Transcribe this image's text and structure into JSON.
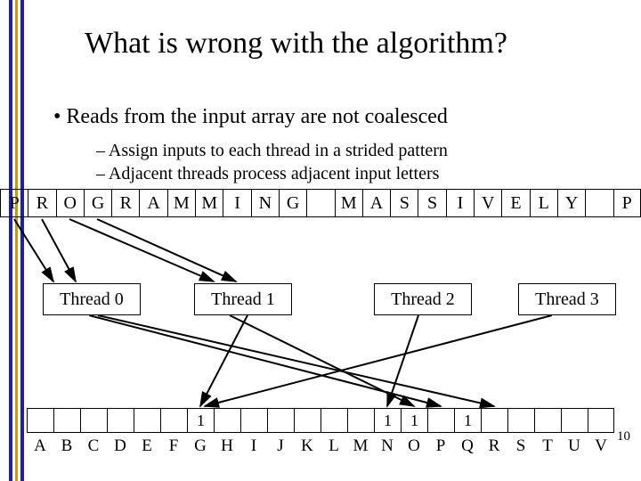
{
  "title": "What is wrong with the algorithm?",
  "bullet1": "Reads from the input array are not coalesced",
  "bullet2a": "Assign inputs to each thread in a strided pattern",
  "bullet2b": "Adjacent threads process adjacent input letters",
  "input_letters": [
    "P",
    "R",
    "O",
    "G",
    "R",
    "A",
    "M",
    "M",
    "I",
    "N",
    "G",
    "",
    "M",
    "A",
    "S",
    "S",
    "I",
    "V",
    "E",
    "L",
    "Y",
    "",
    "P"
  ],
  "threads": [
    "Thread 0",
    "Thread 1",
    "Thread 2",
    "Thread 3"
  ],
  "output_values": [
    "",
    "",
    "",
    "",
    "",
    "",
    "1",
    "",
    "",
    "",
    "",
    "",
    "",
    "1",
    "1",
    "",
    "1",
    "",
    "",
    "",
    "",
    ""
  ],
  "output_labels": [
    "A",
    "B",
    "C",
    "D",
    "E",
    "F",
    "G",
    "H",
    "I",
    "J",
    "K",
    "L",
    "M",
    "N",
    "O",
    "P",
    "Q",
    "R",
    "S",
    "T",
    "U",
    "V"
  ],
  "page_number": "10"
}
